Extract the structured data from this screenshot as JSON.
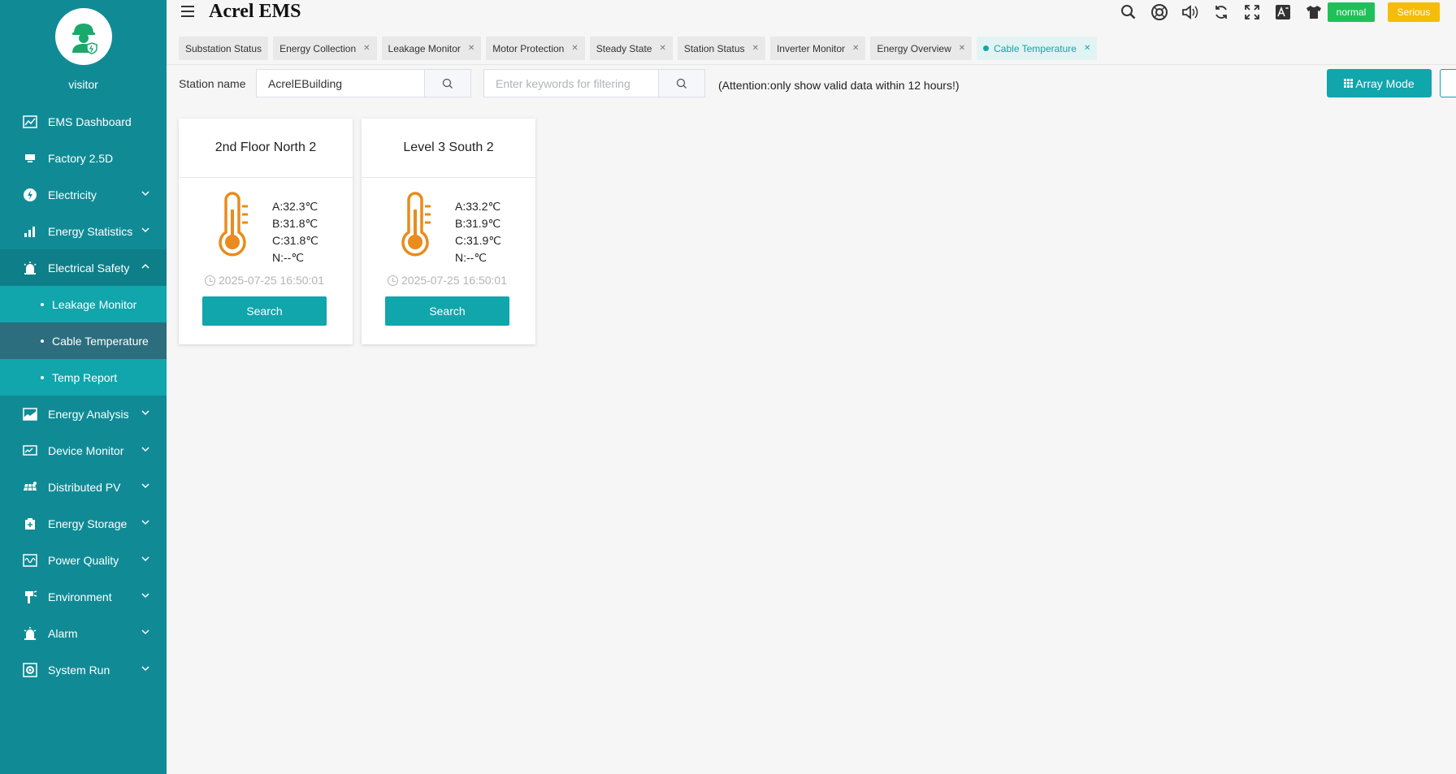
{
  "app": {
    "title": "Acrel EMS"
  },
  "user": {
    "name": "visitor"
  },
  "sidebar": {
    "items": [
      {
        "label": "EMS Dashboard",
        "icon": "dashboard-icon"
      },
      {
        "label": "Factory 2.5D",
        "icon": "monitor-icon"
      },
      {
        "label": "Electricity",
        "icon": "electricity-icon"
      },
      {
        "label": "Energy Statistics",
        "icon": "bar-chart-icon"
      },
      {
        "label": "Electrical Safety",
        "icon": "alarm-light-icon"
      },
      {
        "label": "Energy Analysis",
        "icon": "analysis-icon"
      },
      {
        "label": "Device Monitor",
        "icon": "device-icon"
      },
      {
        "label": "Distributed PV",
        "icon": "solar-panel-icon"
      },
      {
        "label": "Energy Storage",
        "icon": "battery-icon"
      },
      {
        "label": "Power Quality",
        "icon": "waveform-icon"
      },
      {
        "label": "Environment",
        "icon": "environment-icon"
      },
      {
        "label": "Alarm",
        "icon": "bell-icon"
      },
      {
        "label": "System Run",
        "icon": "gear-icon"
      }
    ],
    "sub_items": [
      {
        "label": "Leakage Monitor"
      },
      {
        "label": "Cable Temperature"
      },
      {
        "label": "Temp Report"
      }
    ]
  },
  "toolbar": {
    "normal_label": "normal",
    "serious_label": "Serious"
  },
  "tabs": [
    {
      "label": "Substation Status"
    },
    {
      "label": "Energy Collection"
    },
    {
      "label": "Leakage Monitor"
    },
    {
      "label": "Motor Protection"
    },
    {
      "label": "Steady State"
    },
    {
      "label": "Station Status"
    },
    {
      "label": "Inverter Monitor"
    },
    {
      "label": "Energy Overview"
    },
    {
      "label": "Cable Temperature"
    }
  ],
  "filter": {
    "station_label": "Station name",
    "station_value": "AcrelEBuilding",
    "keyword_placeholder": "Enter keywords for filtering",
    "attention": "(Attention:only show valid data within 12 hours!)",
    "array_mode_label": "Array Mode"
  },
  "cards": [
    {
      "title": "2nd Floor North 2",
      "a": "A:32.3℃",
      "b": "B:31.8℃",
      "c": "C:31.8℃",
      "n": "N:--℃",
      "time": "2025-07-25 16:50:01",
      "button": "Search"
    },
    {
      "title": "Level 3 South 2",
      "a": "A:33.2℃",
      "b": "B:31.9℃",
      "c": "C:31.9℃",
      "n": "N:--℃",
      "time": "2025-07-25 16:50:01",
      "button": "Search"
    }
  ],
  "colors": {
    "sidebar": "#108b96",
    "accent": "#11a5ac",
    "thermometer": "#e98b1d",
    "normal": "#1fc05a",
    "serious": "#f5bd07"
  }
}
